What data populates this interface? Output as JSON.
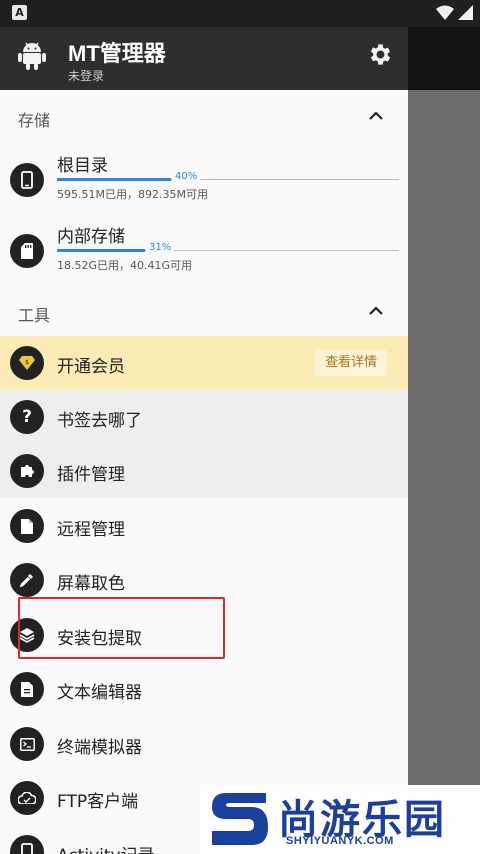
{
  "status_bar": {
    "left_badge": "A"
  },
  "app": {
    "title": "MT管理器",
    "subtitle": "未登录"
  },
  "storage": {
    "header": "存储",
    "items": [
      {
        "name": "根目录",
        "percent_label": "40%",
        "fill": 0.4,
        "detail": "595.51M已用，892.35M可用",
        "icon": "phone-icon"
      },
      {
        "name": "内部存储",
        "percent_label": "31%",
        "fill": 0.31,
        "detail": "18.52G已用，40.41G可用",
        "icon": "sd-card-icon"
      }
    ]
  },
  "tools": {
    "header": "工具",
    "vip_label": "开通会员",
    "vip_button": "查看详情",
    "items": [
      {
        "label": "书签去哪了",
        "icon": "help-icon"
      },
      {
        "label": "插件管理",
        "icon": "puzzle-icon"
      },
      {
        "label": "远程管理",
        "icon": "file-icon"
      },
      {
        "label": "屏幕取色",
        "icon": "eyedropper-icon"
      },
      {
        "label": "安装包提取",
        "icon": "layers-icon"
      },
      {
        "label": "文本编辑器",
        "icon": "document-icon"
      },
      {
        "label": "终端模拟器",
        "icon": "terminal-icon"
      },
      {
        "label": "FTP客户端",
        "icon": "cloud-icon"
      },
      {
        "label": "Activity记录",
        "icon": "phone-icon"
      }
    ]
  },
  "watermark": {
    "brand": "尚游乐园",
    "url": "SHYIYUANYK.COM"
  }
}
